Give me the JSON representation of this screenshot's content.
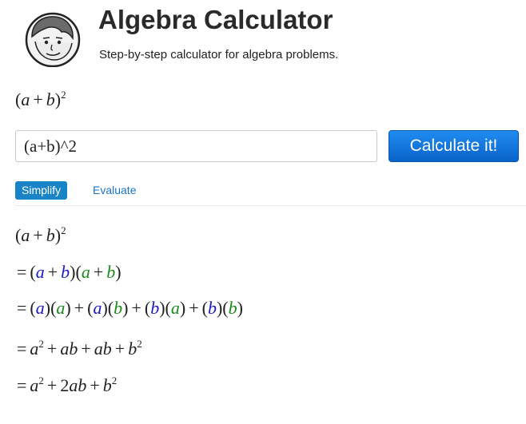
{
  "header": {
    "title": "Algebra Calculator",
    "subtitle": "Step-by-step calculator for algebra problems.",
    "logo_icon": "cartoon-face-logo"
  },
  "input": {
    "value": "(a+b)^2",
    "preview": "(a + b)²"
  },
  "buttons": {
    "calculate": "Calculate it!"
  },
  "tabs": [
    {
      "label": "Simplify",
      "active": true
    },
    {
      "label": "Evaluate",
      "active": false
    }
  ],
  "steps": [
    "(a + b)²",
    "= (a + b)(a + b)",
    "= (a)(a) + (a)(b) + (b)(a) + (b)(b)",
    "= a² + ab + ab + b²",
    "= a² + 2ab + b²"
  ],
  "colors": {
    "button": "#0a63c9",
    "tab_active": "#1983c8",
    "link": "#1a74c4",
    "term_blue": "#1a1ac8",
    "term_green": "#1a8a1a"
  }
}
